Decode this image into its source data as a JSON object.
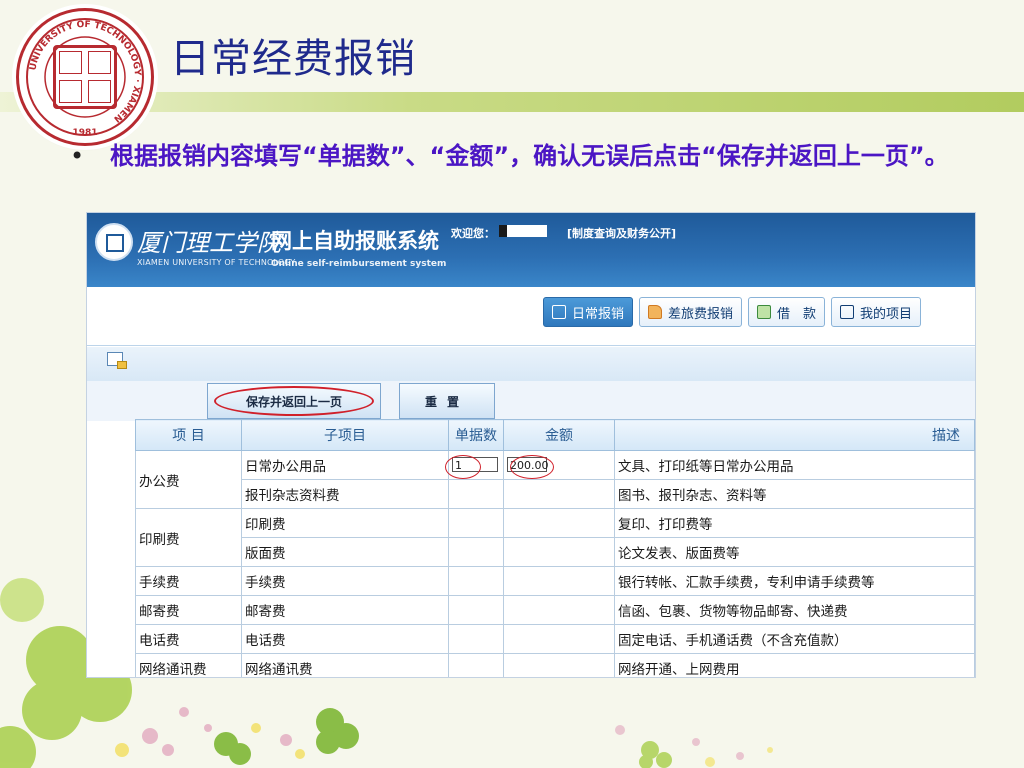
{
  "slide": {
    "title": "日常经费报销",
    "bullet": "根据报销内容填写“单据数”、“金额”，确认无误后点击“保存并返回上一页”。",
    "logo_ring_text": "UNIVERSITY OF TECHNOLOGY · XIAMEN",
    "logo_year": "1981"
  },
  "header": {
    "school_cn": "厦门理工学院",
    "school_en": "XIAMEN UNIVERSITY OF TECHNOLOGY",
    "system_name": "网上自助报账系统",
    "system_name_en": "Online self-reimbursement system",
    "welcome": "欢迎您：",
    "link": "[制度查询及财务公开]"
  },
  "nav": {
    "tabs": [
      {
        "label": "日常报销",
        "icon": "document-icon",
        "active": true
      },
      {
        "label": "差旅费报销",
        "icon": "truck-icon",
        "active": false
      },
      {
        "label": "借　款",
        "icon": "money-icon",
        "active": false
      },
      {
        "label": "我的项目",
        "icon": "list-icon",
        "active": false
      }
    ]
  },
  "form": {
    "save_button": "保存并返回上一页",
    "reset_button": "重置"
  },
  "table": {
    "headers": [
      "项 目",
      "子项目",
      "单据数",
      "金额",
      "描述"
    ],
    "rows": [
      {
        "category": "办公费",
        "sub": "日常办公用品",
        "count": "1",
        "amount": "200.00",
        "desc": "文具、打印纸等日常办公用品"
      },
      {
        "category": "",
        "sub": "报刊杂志资料费",
        "count": "",
        "amount": "",
        "desc": "图书、报刊杂志、资料等"
      },
      {
        "category": "印刷费",
        "sub": "印刷费",
        "count": "",
        "amount": "",
        "desc": "复印、打印费等"
      },
      {
        "category": "",
        "sub": "版面费",
        "count": "",
        "amount": "",
        "desc": "论文发表、版面费等"
      },
      {
        "category": "手续费",
        "sub": "手续费",
        "count": "",
        "amount": "",
        "desc": "银行转帐、汇款手续费，专利申请手续费等"
      },
      {
        "category": "邮寄费",
        "sub": "邮寄费",
        "count": "",
        "amount": "",
        "desc": "信函、包裹、货物等物品邮寄、快递费"
      },
      {
        "category": "电话费",
        "sub": "电话费",
        "count": "",
        "amount": "",
        "desc": "固定电话、手机通话费（不含充值款）"
      },
      {
        "category": "网络通讯费",
        "sub": "网络通讯费",
        "count": "",
        "amount": "",
        "desc": "网络开通、上网费用"
      }
    ]
  },
  "colors": {
    "title": "#1f2a8c",
    "bullet": "#4b16c4",
    "header_blue": "#2c6fb3",
    "annotation_red": "#d0202a"
  }
}
